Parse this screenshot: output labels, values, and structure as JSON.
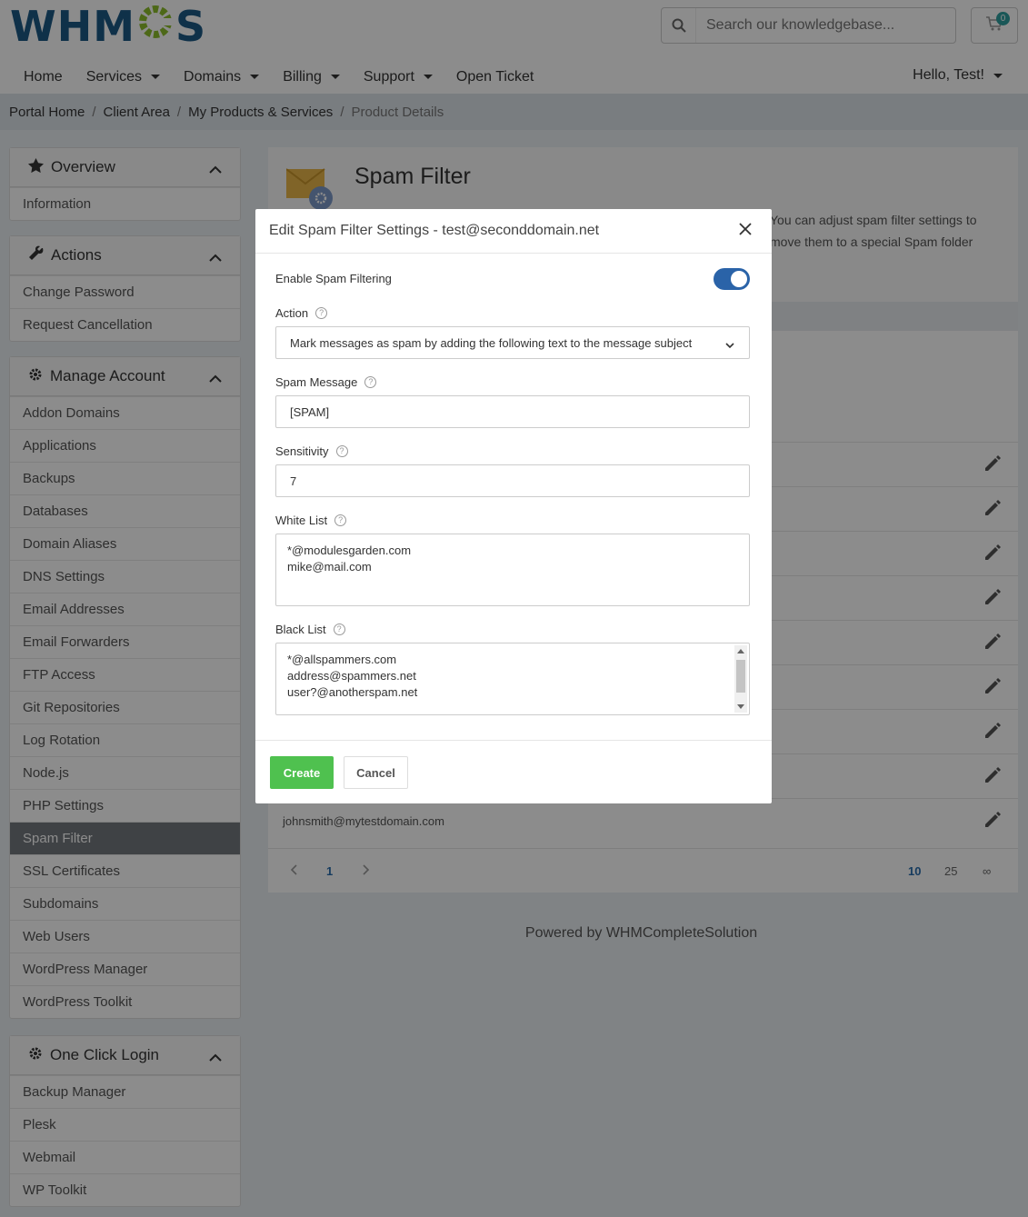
{
  "header": {
    "logo_text": "WHMCS",
    "search_placeholder": "Search our knowledgebase...",
    "cart_count": "0"
  },
  "nav": {
    "items": [
      "Home",
      "Services",
      "Domains",
      "Billing",
      "Support",
      "Open Ticket"
    ],
    "user_greeting": "Hello, Test!"
  },
  "breadcrumb": [
    "Portal Home",
    "Client Area",
    "My Products & Services",
    "Product Details"
  ],
  "sidebar": {
    "overview": {
      "title": "Overview",
      "items": [
        "Information"
      ]
    },
    "actions": {
      "title": "Actions",
      "items": [
        "Change Password",
        "Request Cancellation"
      ]
    },
    "manage": {
      "title": "Manage Account",
      "items": [
        "Addon Domains",
        "Applications",
        "Backups",
        "Databases",
        "Domain Aliases",
        "DNS Settings",
        "Email Addresses",
        "Email Forwarders",
        "FTP Access",
        "Git Repositories",
        "Log Rotation",
        "Node.js",
        "PHP Settings",
        "Spam Filter",
        "SSL Certificates",
        "Subdomains",
        "Web Users",
        "WordPress Manager",
        "WordPress Toolkit"
      ],
      "active": "Spam Filter"
    },
    "oneclick": {
      "title": "One Click Login",
      "items": [
        "Backup Manager",
        "Plesk",
        "Webmail",
        "WP Toolkit"
      ]
    }
  },
  "main": {
    "title": "Spam Filter",
    "description_line1": "You can adjust spam filter settings to",
    "description_line2": "move them to a special Spam folder",
    "last_row_email": "johnsmith@mytestdomain.com",
    "pagination": {
      "page": "1",
      "sizes": [
        "10",
        "25",
        "∞"
      ]
    }
  },
  "footer": {
    "text": "Powered by WHMCompleteSolution"
  },
  "modal": {
    "title": "Edit Spam Filter Settings - test@seconddomain.net",
    "enable_label": "Enable Spam Filtering",
    "enable_value": true,
    "action_label": "Action",
    "action_value": "Mark messages as spam by adding the following text to the message subject",
    "spam_message_label": "Spam Message",
    "spam_message_value": "[SPAM]",
    "sensitivity_label": "Sensitivity",
    "sensitivity_value": "7",
    "whitelist_label": "White List",
    "whitelist_values": [
      "*@modulesgarden.com",
      "mike@mail.com"
    ],
    "blacklist_label": "Black List",
    "blacklist_values": [
      "*@allspammers.com",
      "address@spammers.net",
      "user?@anotherspam.net"
    ],
    "create_label": "Create",
    "cancel_label": "Cancel"
  }
}
